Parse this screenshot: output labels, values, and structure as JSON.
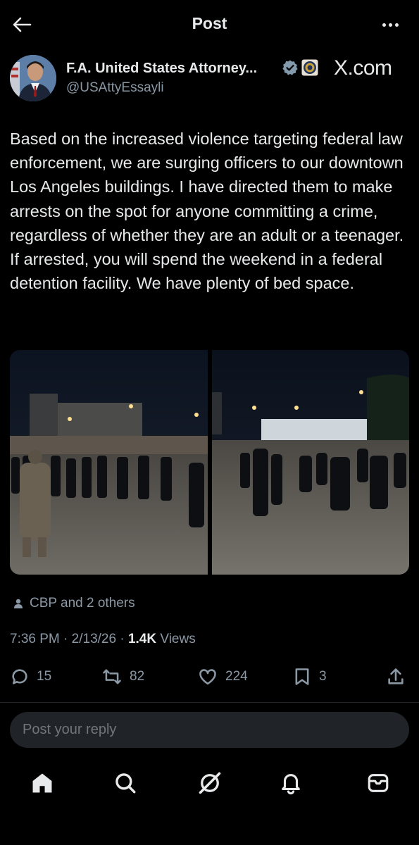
{
  "header": {
    "title": "Post"
  },
  "author": {
    "name": "F.A. United States Attorney...",
    "handle": "@USAttyEssayli",
    "watermark": "X.com"
  },
  "tweet": {
    "text": "Based on the increased violence targeting federal law enforcement, we are surging officers to our downtown Los Angeles buildings. I have directed them to make arrests on the spot for anyone committing a crime, regardless of whether they are an adult or a teenager. If arrested, you will spend the weekend in a federal detention facility. We have plenty of bed space."
  },
  "liked_by": "CBP and 2 others",
  "meta": {
    "time": "7:36 PM",
    "date": "2/13/26",
    "views_count": "1.4K",
    "views_label": "Views"
  },
  "actions": {
    "replies": "15",
    "reposts": "82",
    "likes": "224",
    "bookmarks": "3"
  },
  "reply_box": {
    "placeholder": "Post your reply"
  },
  "colors": {
    "background": "#000000",
    "text": "#e7e9ea",
    "secondary": "#8b98a5",
    "verified": "#829aab",
    "reply_bg": "#202327"
  },
  "icons": [
    "back-arrow-icon",
    "more-icon",
    "verified-icon",
    "doj-seal-icon",
    "person-icon",
    "reply-icon",
    "repost-icon",
    "like-icon",
    "bookmark-icon",
    "share-icon",
    "home-icon",
    "search-icon",
    "grok-icon",
    "notifications-icon",
    "messages-icon"
  ]
}
